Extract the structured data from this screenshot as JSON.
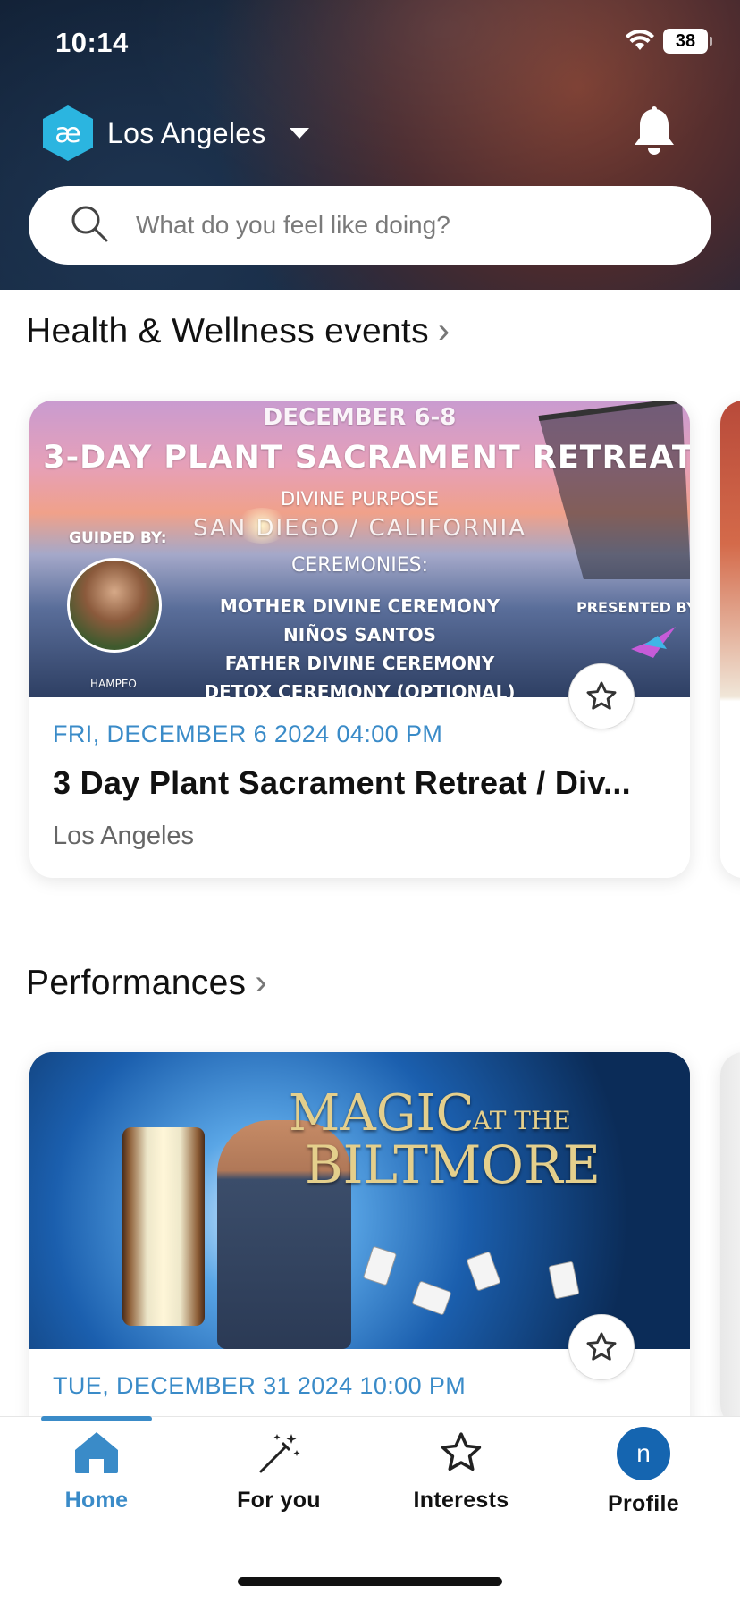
{
  "status": {
    "time": "10:14",
    "battery": "38"
  },
  "header": {
    "location": "Los Angeles",
    "search_placeholder": "What do you feel like doing?"
  },
  "sections": [
    {
      "title": "Health & Wellness events",
      "card": {
        "date": "FRI, DECEMBER 6 2024 04:00 PM",
        "title": "3 Day Plant Sacrament Retreat / Div...",
        "location": "Los Angeles",
        "image_text": {
          "dates": "DECEMBER 6-8",
          "headline": "3-DAY PLANT SACRAMENT RETREAT",
          "subtitle": "DIVINE PURPOSE",
          "place": "SAN DIEGO / CALIFORNIA",
          "guided_by": "GUIDED BY:",
          "ceremonies": "CEREMONIES:",
          "ceremony_1": "MOTHER DIVINE CEREMONY",
          "ceremony_2": "NIÑOS SANTOS",
          "ceremony_3": "FATHER DIVINE CEREMONY",
          "ceremony_4": "DETOX CEREMONY (OPTIONAL)",
          "presented_by": "PRESENTED BY:",
          "guide_name": "HAMPEO"
        }
      }
    },
    {
      "title": "Performances",
      "card": {
        "date": "TUE, DECEMBER 31 2024 10:00 PM",
        "image_text": {
          "line1_big": "MAGIC",
          "line1_small": "AT THE",
          "line2": "BILTMORE"
        }
      }
    }
  ],
  "tabs": [
    {
      "label": "Home",
      "icon": "home-icon",
      "active": true
    },
    {
      "label": "For you",
      "icon": "magic-wand-icon",
      "active": false
    },
    {
      "label": "Interests",
      "icon": "star-icon",
      "active": false
    },
    {
      "label": "Profile",
      "icon": "avatar",
      "avatar_letter": "n",
      "active": false
    }
  ],
  "colors": {
    "accent": "#3a8bc8",
    "avatar": "#1565b0",
    "logo": "#2bb5e0"
  }
}
